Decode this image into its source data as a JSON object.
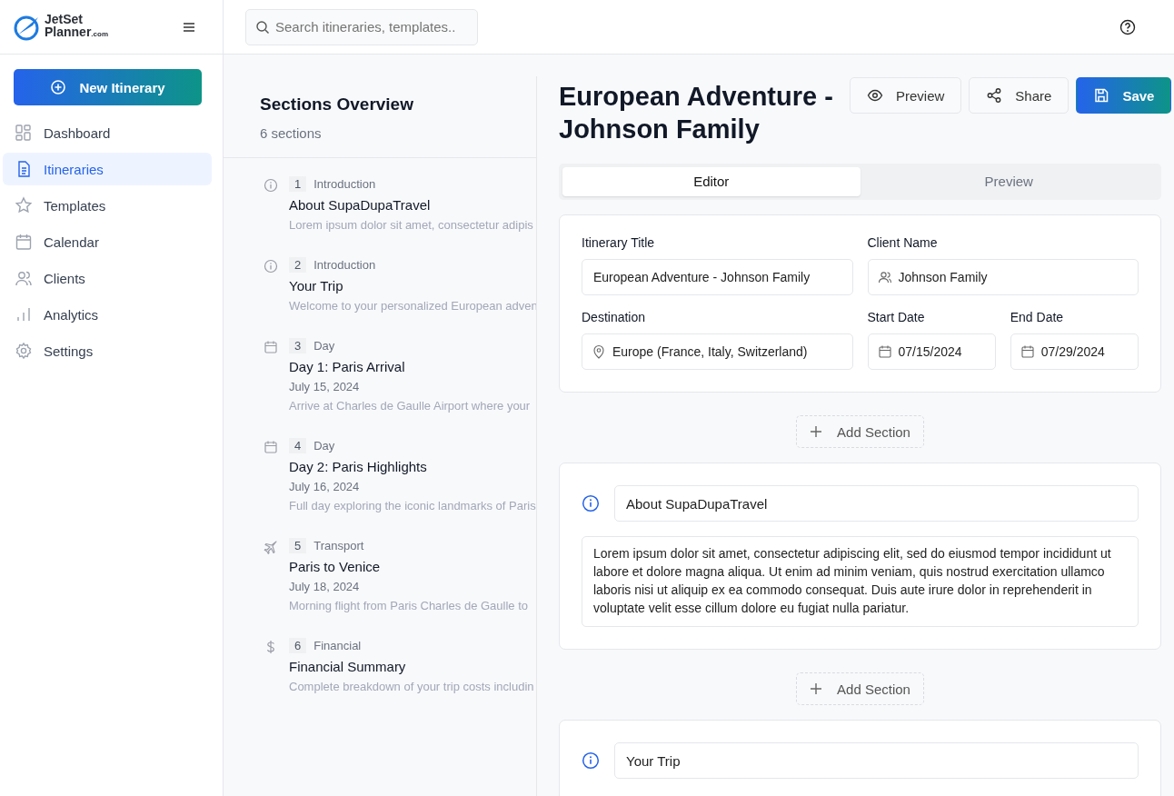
{
  "brand": {
    "name_top": "JetSet",
    "name_bottom": "Planner",
    "suffix": ".com"
  },
  "search": {
    "placeholder": "Search itineraries, templates.."
  },
  "new_button": "New Itinerary",
  "nav": [
    {
      "label": "Dashboard",
      "selected": false
    },
    {
      "label": "Itineraries",
      "selected": true
    },
    {
      "label": "Templates",
      "selected": false
    },
    {
      "label": "Calendar",
      "selected": false
    },
    {
      "label": "Clients",
      "selected": false
    },
    {
      "label": "Analytics",
      "selected": false
    },
    {
      "label": "Settings",
      "selected": false
    }
  ],
  "overview": {
    "title": "Sections Overview",
    "count": "6 sections",
    "sections": [
      {
        "kind": "info",
        "number": "1",
        "type": "Introduction",
        "title": "About SupaDupaTravel",
        "summary": "Lorem ipsum dolor sit amet, consectetur adipis"
      },
      {
        "kind": "info",
        "number": "2",
        "type": "Introduction",
        "title": "Your Trip",
        "summary": "Welcome to your personalized European adven"
      },
      {
        "kind": "day",
        "number": "3",
        "type": "Day",
        "title": "Day 1: Paris Arrival",
        "date": "July 15, 2024",
        "summary": "Arrive at Charles de Gaulle Airport where your"
      },
      {
        "kind": "day",
        "number": "4",
        "type": "Day",
        "title": "Day 2: Paris Highlights",
        "date": "July 16, 2024",
        "summary": "Full day exploring the iconic landmarks of Paris"
      },
      {
        "kind": "transport",
        "number": "5",
        "type": "Transport",
        "title": "Paris to Venice",
        "date": "July 18, 2024",
        "summary": "Morning flight from Paris Charles de Gaulle to"
      },
      {
        "kind": "financial",
        "number": "6",
        "type": "Financial",
        "title": "Financial Summary",
        "summary": "Complete breakdown of your trip costs includin"
      }
    ]
  },
  "title": "European Adventure - Johnson Family",
  "actions": [
    {
      "kind": "preview",
      "label": "Preview"
    },
    {
      "kind": "share",
      "label": "Share"
    },
    {
      "kind": "save",
      "label": "Save"
    }
  ],
  "tabs": [
    {
      "label": "Editor",
      "selected": true
    },
    {
      "label": "Preview",
      "selected": false
    }
  ],
  "form": {
    "title_label": "Itinerary Title",
    "title_value": "European Adventure - Johnson Family",
    "client_label": "Client Name",
    "client_value": "Johnson Family",
    "destination_label": "Destination",
    "destination_value": "Europe (France, Italy, Switzerland)",
    "start_label": "Start Date",
    "start_value": "07/15/2024",
    "end_label": "End Date",
    "end_value": "07/29/2024"
  },
  "editor_sections": [
    {
      "kind": "info",
      "add_label": "Add Section",
      "title": "About SupaDupaTravel",
      "body": "Lorem ipsum dolor sit amet, consectetur adipiscing elit, sed do eiusmod tempor incididunt ut labore et dolore magna aliqua. Ut enim ad minim veniam, quis nostrud exercitation ullamco laboris nisi ut aliquip ex ea commodo consequat. Duis aute irure dolor in reprehenderit in voluptate velit esse cillum dolore eu fugiat nulla pariatur."
    },
    {
      "kind": "info",
      "add_label": "Add Section",
      "title": "Your Trip"
    }
  ]
}
